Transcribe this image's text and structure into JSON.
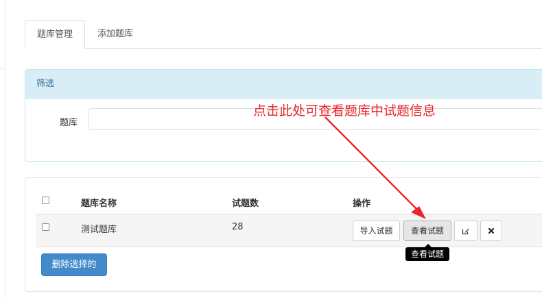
{
  "tabs": [
    {
      "label": "题库管理",
      "active": true
    },
    {
      "label": "添加题库",
      "active": false
    }
  ],
  "filter": {
    "title": "筛选",
    "bank_label": "题库",
    "bank_value": ""
  },
  "annotation": {
    "text": "点击此处可查看题库中试题信息",
    "color": "#e8262b"
  },
  "table": {
    "columns": [
      "题库名称",
      "试题数",
      "操作"
    ],
    "rows": [
      {
        "name": "测试题库",
        "count": "28",
        "checked": false
      }
    ],
    "actions": {
      "import_label": "导入试题",
      "view_label": "查看试题",
      "edit_icon": "edit-icon",
      "delete_icon": "close-icon"
    },
    "tooltip": "查看试题"
  },
  "bulk_delete_label": "删除选择的",
  "colors": {
    "primary": "#428bca",
    "panel_heading_bg": "#d9edf7",
    "panel_heading_text": "#31708f"
  }
}
